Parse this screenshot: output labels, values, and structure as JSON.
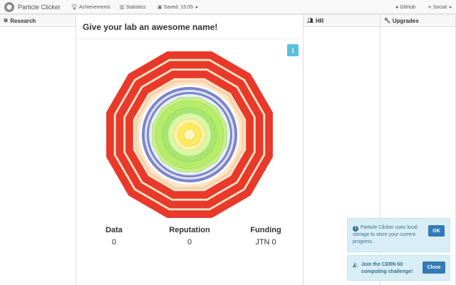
{
  "navbar": {
    "brand": "Particle Clicker",
    "items": [
      {
        "icon": "trophy-icon",
        "label": "Achievements"
      },
      {
        "icon": "bar-chart-icon",
        "label": "Statistics"
      },
      {
        "icon": "save-icon",
        "label": "Saved: 15:05"
      }
    ],
    "github": "GitHub",
    "social": "Social"
  },
  "columns": {
    "research": "Research",
    "hr": "HR",
    "upgrades": "Upgrades"
  },
  "lab": {
    "name": "Give your lab an awesome name!",
    "info_button": "i"
  },
  "stats": {
    "data_label": "Data",
    "data_value": "0",
    "reputation_label": "Reputation",
    "reputation_value": "0",
    "funding_label": "Funding",
    "funding_value": "JTN 0"
  },
  "alerts": {
    "storage_text": "Particle Clicker uses local storage to store your current progress.",
    "storage_button": "OK",
    "cern_text": "Join the CERN 60 computing challenge!",
    "cern_button": "Close"
  },
  "colors": {
    "outer_ring": "#e8392a",
    "ring_gap": "#fbe3c4",
    "blue_ring": "#7b86c9",
    "green": "#b6ec6a",
    "yellow": "#ffec5c",
    "info": "#5bc0de",
    "primary": "#337ab7"
  }
}
